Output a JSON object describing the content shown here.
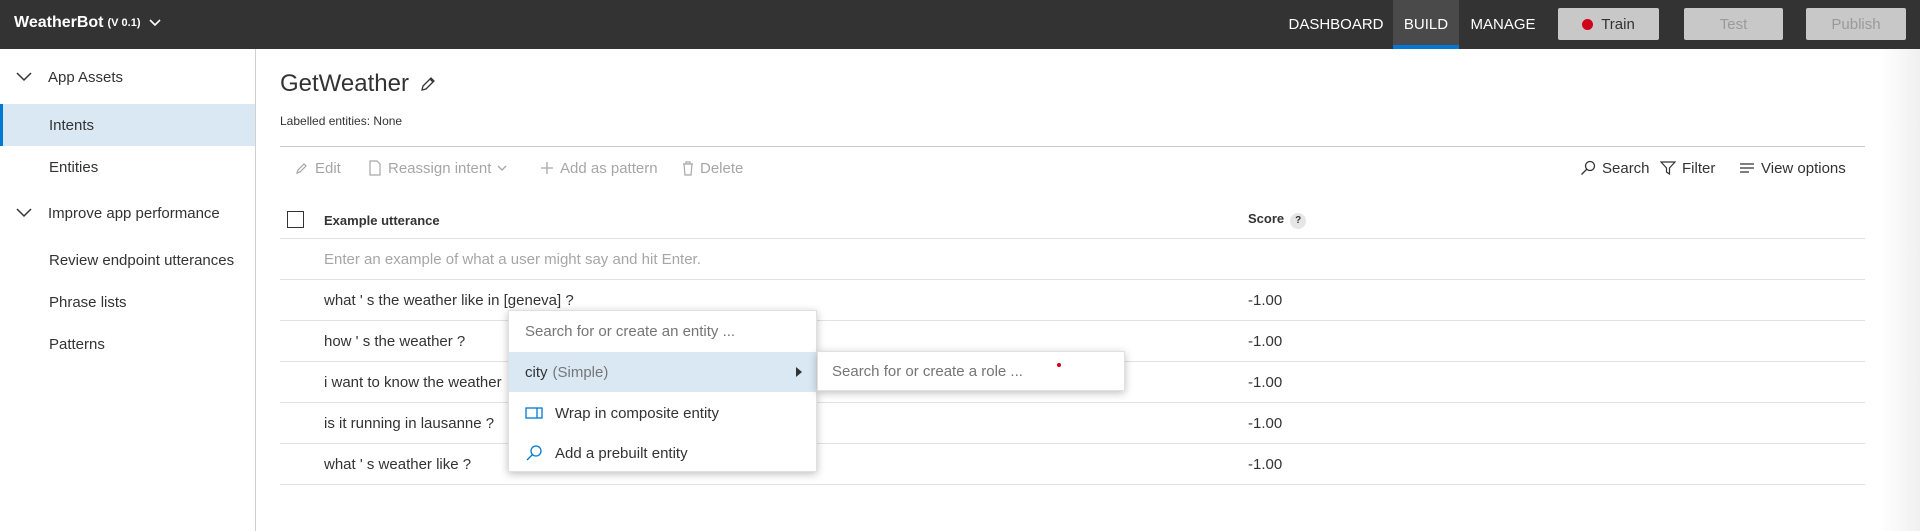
{
  "topbar": {
    "app_name": "WeatherBot",
    "app_version": "(V 0.1)",
    "nav": {
      "dashboard": "DASHBOARD",
      "build": "BUILD",
      "manage": "MANAGE"
    },
    "buttons": {
      "train": "Train",
      "test": "Test",
      "publish": "Publish"
    },
    "accent_color": "#0078d4",
    "train_status_color": "#d0021b"
  },
  "sidebar": {
    "groups": [
      {
        "label": "App Assets",
        "items": [
          {
            "label": "Intents",
            "active": true
          },
          {
            "label": "Entities"
          }
        ]
      },
      {
        "label": "Improve app performance",
        "items": [
          {
            "label": "Review endpoint utterances"
          },
          {
            "label": "Phrase lists"
          },
          {
            "label": "Patterns"
          }
        ]
      }
    ]
  },
  "main": {
    "title": "GetWeather",
    "labelled_entities": "Labelled entities: None",
    "toolbar": {
      "edit": "Edit",
      "reassign": "Reassign intent",
      "add_pattern": "Add as pattern",
      "delete": "Delete",
      "search": "Search",
      "filter": "Filter",
      "view_options": "View options"
    },
    "table": {
      "col_utterance": "Example utterance",
      "col_score": "Score",
      "help": "?",
      "new_placeholder": "Enter an example of what a user might say and hit Enter.",
      "rows": [
        {
          "utterance": "what ' s the weather like in [geneva] ?",
          "score": "-1.00"
        },
        {
          "utterance": "how ' s the weather ?",
          "score": "-1.00"
        },
        {
          "utterance": "i want to know the weather",
          "score": "-1.00"
        },
        {
          "utterance": "is it running in lausanne ?",
          "score": "-1.00"
        },
        {
          "utterance": "what ' s weather like ?",
          "score": "-1.00"
        }
      ]
    }
  },
  "entity_menu": {
    "search_placeholder": "Search for or create an entity ...",
    "selected_entity": "city",
    "selected_entity_type": "(Simple)",
    "wrap_composite": "Wrap in composite entity",
    "add_prebuilt": "Add a prebuilt entity",
    "role_placeholder": "Search for or create a role ..."
  }
}
